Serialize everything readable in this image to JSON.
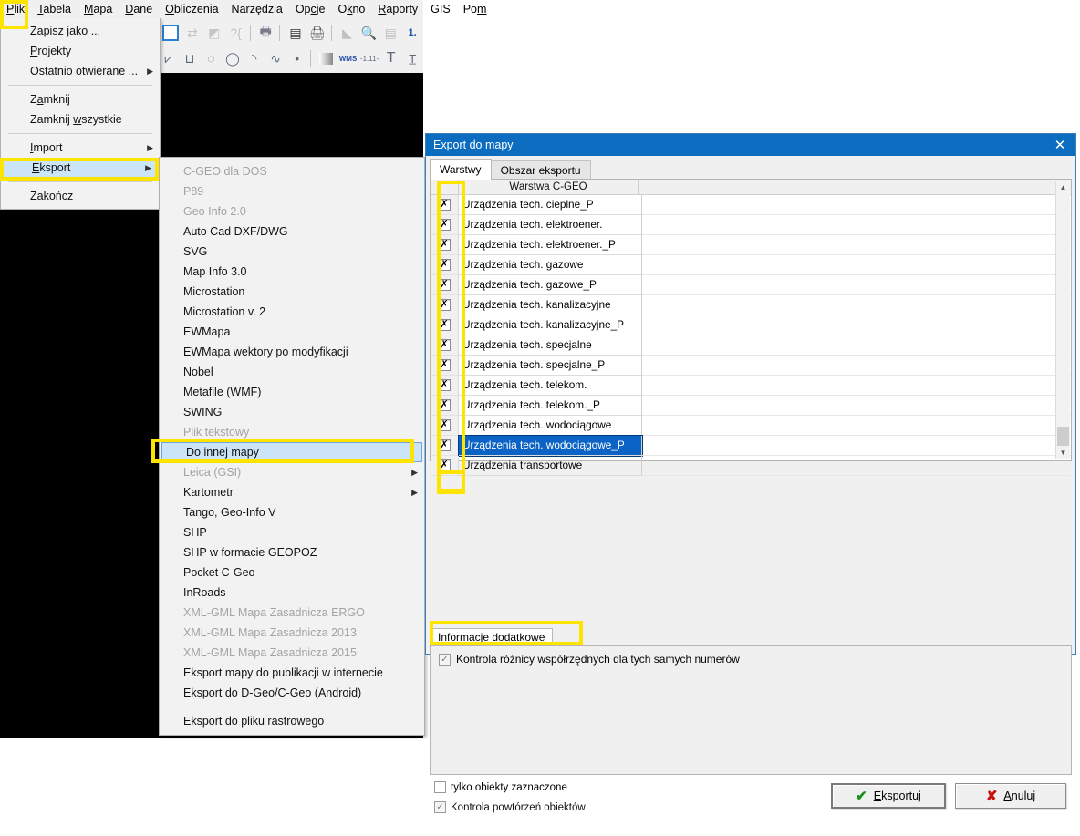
{
  "app": {
    "menubar": [
      {
        "label": "Plik",
        "accel": "P"
      },
      {
        "label": "Tabela",
        "accel": "T"
      },
      {
        "label": "Mapa",
        "accel": "M"
      },
      {
        "label": "Dane",
        "accel": "D"
      },
      {
        "label": "Obliczenia",
        "accel": "O"
      },
      {
        "label": "Narzędzia",
        "accel": ""
      },
      {
        "label": "Opcje",
        "accel": "c"
      },
      {
        "label": "Okno",
        "accel": "k"
      },
      {
        "label": "Raporty",
        "accel": "R"
      },
      {
        "label": "GIS",
        "accel": ""
      },
      {
        "label": "Pom",
        "accel": "m"
      }
    ],
    "toolbar_row1_icons": [
      "checkbox-icon",
      "square-select-icon",
      "swap-icon",
      "mask-icon",
      "query-icon",
      "print-preview-icon",
      "list-icon",
      "print-icon",
      "terrain-icon",
      "zoom-search-icon",
      "copy-layers-icon",
      "numbering-icon"
    ],
    "toolbar_row2_icons": [
      "polyline-fill-icon",
      "polygon-icon",
      "rectangle-corner-icon",
      "arc-dashed-icon",
      "circle-icon",
      "arc-icon",
      "spline-icon",
      "point-icon",
      "gradient-icon",
      "wms-icon",
      "dimension-icon",
      "text-icon",
      "text-baseline-icon"
    ]
  },
  "file_menu": {
    "items": [
      {
        "label": "Zapisz jako ...",
        "accel": "",
        "type": "item",
        "state": "normal",
        "arrow": false
      },
      {
        "label": "Projekty",
        "accel": "P",
        "type": "item",
        "state": "normal",
        "arrow": false
      },
      {
        "label": "Ostatnio otwierane ...",
        "accel": "",
        "type": "item",
        "state": "normal",
        "arrow": true
      },
      {
        "label": "",
        "type": "separator"
      },
      {
        "label": "Zamknij",
        "accel": "a",
        "type": "item",
        "state": "normal",
        "arrow": false
      },
      {
        "label": "Zamknij wszystkie",
        "accel": "w",
        "type": "item",
        "state": "normal",
        "arrow": false
      },
      {
        "label": "",
        "type": "separator"
      },
      {
        "label": "Import",
        "accel": "I",
        "type": "item",
        "state": "normal",
        "arrow": true
      },
      {
        "label": "Eksport",
        "accel": "E",
        "type": "item",
        "state": "selected",
        "arrow": true
      },
      {
        "label": "",
        "type": "separator"
      },
      {
        "label": "Zakończ",
        "accel": "k",
        "type": "item",
        "state": "normal",
        "arrow": false
      }
    ]
  },
  "export_submenu": {
    "items": [
      {
        "label": "C-GEO dla DOS",
        "type": "item",
        "state": "disabled",
        "arrow": false
      },
      {
        "label": "P89",
        "type": "item",
        "state": "disabled",
        "arrow": false
      },
      {
        "label": "Geo Info 2.0",
        "type": "item",
        "state": "disabled",
        "arrow": false
      },
      {
        "label": "Auto Cad DXF/DWG",
        "type": "item",
        "state": "normal",
        "arrow": false
      },
      {
        "label": "SVG",
        "type": "item",
        "state": "normal",
        "arrow": false
      },
      {
        "label": "Map Info 3.0",
        "type": "item",
        "state": "normal",
        "arrow": false
      },
      {
        "label": "Microstation",
        "type": "item",
        "state": "normal",
        "arrow": false
      },
      {
        "label": "Microstation v. 2",
        "type": "item",
        "state": "normal",
        "arrow": false
      },
      {
        "label": "EWMapa",
        "type": "item",
        "state": "normal",
        "arrow": false
      },
      {
        "label": "EWMapa wektory po modyfikacji",
        "type": "item",
        "state": "normal",
        "arrow": false
      },
      {
        "label": "Nobel",
        "type": "item",
        "state": "normal",
        "arrow": false
      },
      {
        "label": "Metafile (WMF)",
        "type": "item",
        "state": "normal",
        "arrow": false
      },
      {
        "label": "SWING",
        "type": "item",
        "state": "normal",
        "arrow": false
      },
      {
        "label": "Plik tekstowy",
        "type": "item",
        "state": "disabled",
        "arrow": false
      },
      {
        "label": "Do innej mapy",
        "type": "item",
        "state": "selected",
        "arrow": false
      },
      {
        "label": "Leica (GSI)",
        "type": "item",
        "state": "disabled",
        "arrow": true
      },
      {
        "label": "Kartometr",
        "type": "item",
        "state": "normal",
        "arrow": true
      },
      {
        "label": "Tango, Geo-Info V",
        "type": "item",
        "state": "normal",
        "arrow": false
      },
      {
        "label": "SHP",
        "type": "item",
        "state": "normal",
        "arrow": false
      },
      {
        "label": "SHP w formacie GEOPOZ",
        "type": "item",
        "state": "normal",
        "arrow": false
      },
      {
        "label": "Pocket C-Geo",
        "type": "item",
        "state": "normal",
        "arrow": false
      },
      {
        "label": "InRoads",
        "type": "item",
        "state": "normal",
        "arrow": false
      },
      {
        "label": "XML-GML Mapa Zasadnicza ERGO",
        "type": "item",
        "state": "disabled",
        "arrow": false
      },
      {
        "label": "XML-GML Mapa Zasadnicza 2013",
        "type": "item",
        "state": "disabled",
        "arrow": false
      },
      {
        "label": "XML-GML Mapa Zasadnicza 2015",
        "type": "item",
        "state": "disabled",
        "arrow": false
      },
      {
        "label": "Eksport mapy do publikacji w internecie",
        "type": "item",
        "state": "normal",
        "arrow": false
      },
      {
        "label": "Eksport do D-Geo/C-Geo (Android)",
        "type": "item",
        "state": "normal",
        "arrow": false
      },
      {
        "label": "",
        "type": "separator"
      },
      {
        "label": "Eksport do pliku rastrowego",
        "type": "item",
        "state": "normal",
        "arrow": false
      }
    ]
  },
  "dialog": {
    "title": "Export do mapy",
    "close_icon": "✕",
    "tabs": [
      {
        "label": "Warstwy",
        "active": true
      },
      {
        "label": "Obszar eksportu",
        "active": false
      }
    ],
    "grid": {
      "column_header": "Warstwa C-GEO",
      "checkmark": "✗",
      "rows": [
        {
          "label": "Urządzenia tech. cieplne_P",
          "checked": true,
          "selected": false
        },
        {
          "label": "Urządzenia tech. elektroener.",
          "checked": true,
          "selected": false
        },
        {
          "label": "Urządzenia tech. elektroener._P",
          "checked": true,
          "selected": false
        },
        {
          "label": "Urządzenia tech. gazowe",
          "checked": true,
          "selected": false
        },
        {
          "label": "Urządzenia tech. gazowe_P",
          "checked": true,
          "selected": false
        },
        {
          "label": "Urządzenia tech. kanalizacyjne",
          "checked": true,
          "selected": false
        },
        {
          "label": "Urządzenia tech. kanalizacyjne_P",
          "checked": true,
          "selected": false
        },
        {
          "label": "Urządzenia tech. specjalne",
          "checked": true,
          "selected": false
        },
        {
          "label": "Urządzenia tech. specjalne_P",
          "checked": true,
          "selected": false
        },
        {
          "label": "Urządzenia tech. telekom.",
          "checked": true,
          "selected": false
        },
        {
          "label": "Urządzenia tech. telekom._P",
          "checked": true,
          "selected": false
        },
        {
          "label": "Urządzenia tech. wodociągowe",
          "checked": true,
          "selected": false
        },
        {
          "label": "Urządzenia tech. wodociągowe_P",
          "checked": true,
          "selected": true
        },
        {
          "label": "Urządzenia transportowe",
          "checked": true,
          "selected": false
        }
      ]
    },
    "info_tab": "Informacje dodatkowe",
    "info_checkbox": {
      "label": "Kontrola różnicy współrzędnych dla tych samych numerów",
      "checked": true
    },
    "bottom": {
      "only_selected": {
        "label": "tylko obiekty zaznaczone",
        "checked": false
      },
      "duplicate_control": {
        "label": "Kontrola powtórzeń obiektów",
        "checked": true
      }
    },
    "buttons": {
      "export": {
        "label": "Eksportuj",
        "accel": "E",
        "icon": "check-icon"
      },
      "cancel": {
        "label": "Anuluj",
        "accel": "A",
        "icon": "x-icon"
      }
    }
  },
  "highlights": {
    "color": "#ffe400",
    "boxes": [
      "plik-menu",
      "eksport-item",
      "do-innej-mapy-item",
      "checkbox-column",
      "informacje-dodatkowe-tab",
      "tylko-obiekty-zaznaczone"
    ]
  }
}
